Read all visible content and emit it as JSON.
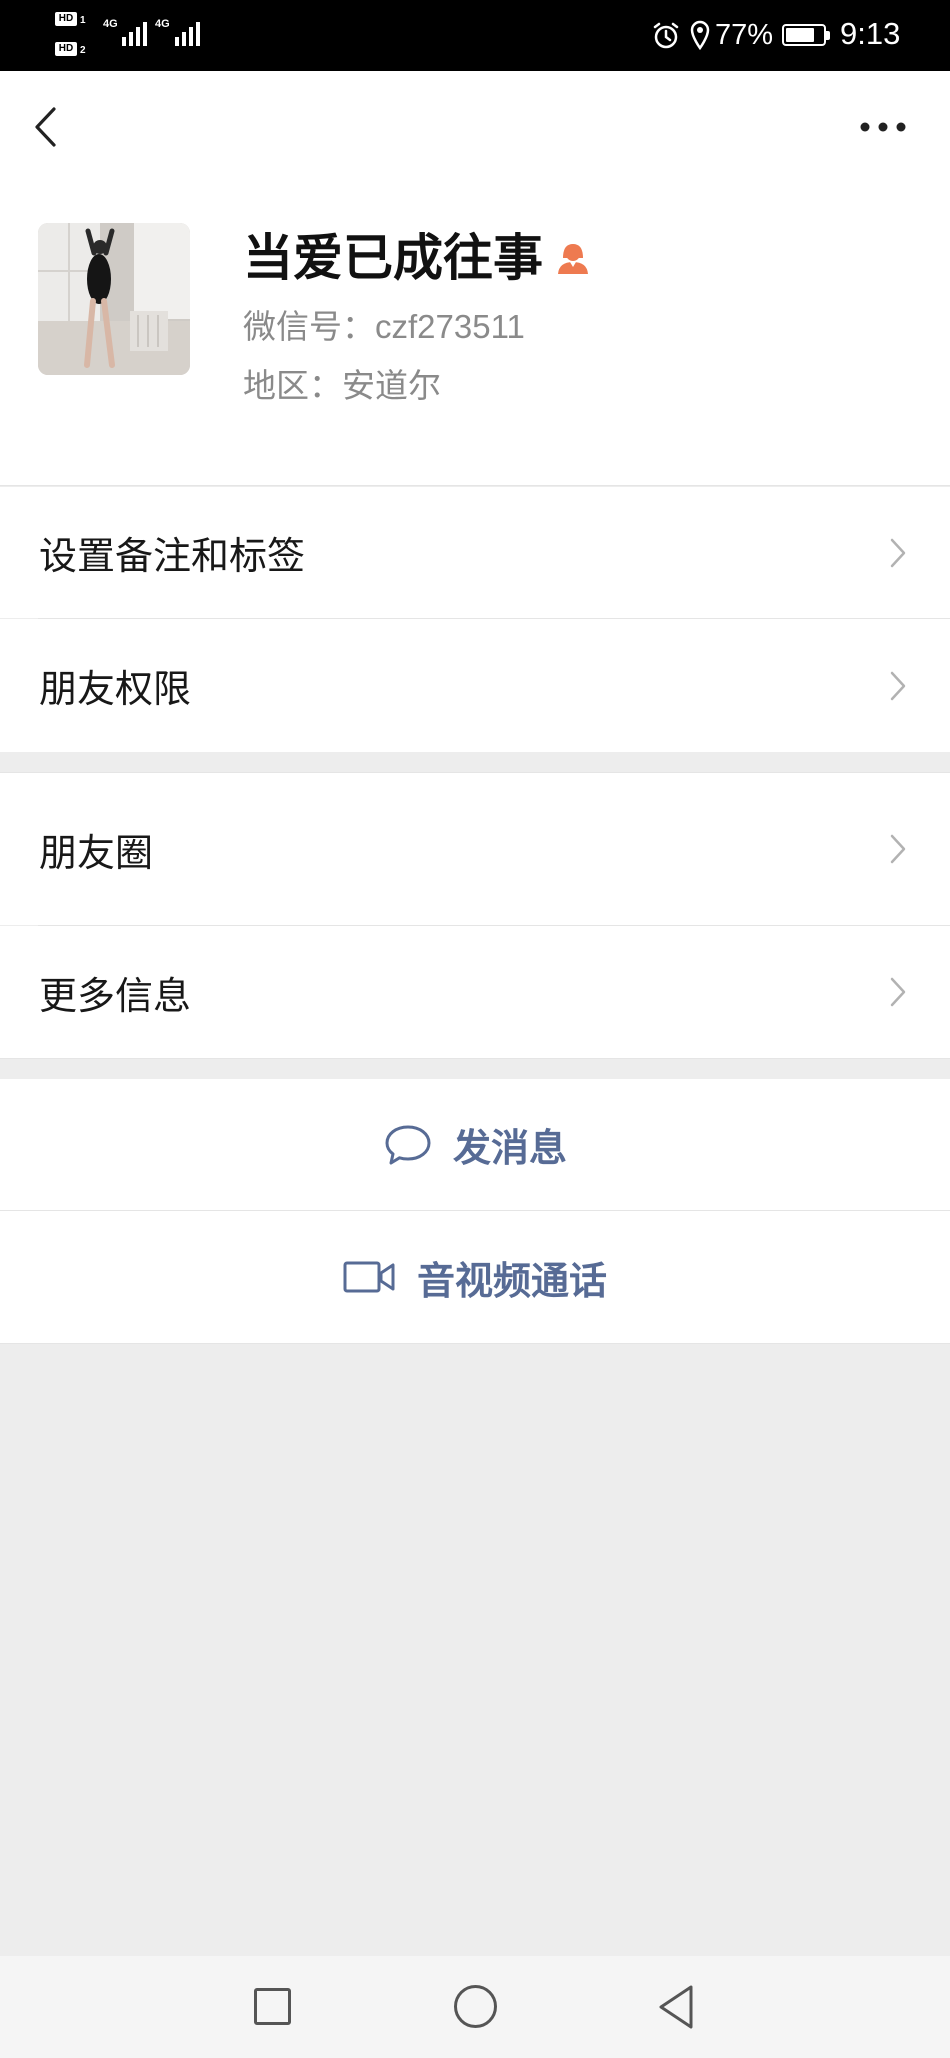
{
  "status_bar": {
    "sim1_badge": "HD",
    "sim1_slot": "1",
    "sim2_badge": "HD",
    "sim2_slot": "2",
    "network1": "4G",
    "network2": "4G",
    "battery_percent": "77%",
    "battery_level": 0.77,
    "time": "9:13",
    "icons": {
      "alarm": "alarm-icon",
      "location": "location-icon",
      "battery": "battery-icon",
      "signal": "signal-bars-icon"
    }
  },
  "header": {
    "back_icon": "chevron-left-icon",
    "more_icon": "more-dots-icon"
  },
  "profile": {
    "avatar": "avatar-photo",
    "name": "当爱已成往事",
    "gender_icon": "female-icon",
    "wechat_id_label": "微信号：",
    "wechat_id": "czf273511",
    "region_label": "地区：",
    "region": "安道尔"
  },
  "menu": {
    "group1": [
      {
        "label": "设置备注和标签",
        "icon": "chevron-right-icon"
      },
      {
        "label": "朋友权限",
        "icon": "chevron-right-icon"
      }
    ],
    "group2": [
      {
        "label": "朋友圈",
        "icon": "chevron-right-icon"
      },
      {
        "label": "更多信息",
        "icon": "chevron-right-icon"
      }
    ]
  },
  "actions": {
    "send_message": {
      "label": "发消息",
      "icon": "chat-bubble-icon"
    },
    "video_call": {
      "label": "音视频通话",
      "icon": "video-camera-icon"
    }
  },
  "nav_bar": {
    "icons": [
      "recent-apps-icon",
      "home-icon",
      "back-icon"
    ]
  },
  "colors": {
    "accent": "#576b95",
    "page_background": "#ededed",
    "gender_female": "#ee7a50",
    "status_bar": "#000000"
  }
}
